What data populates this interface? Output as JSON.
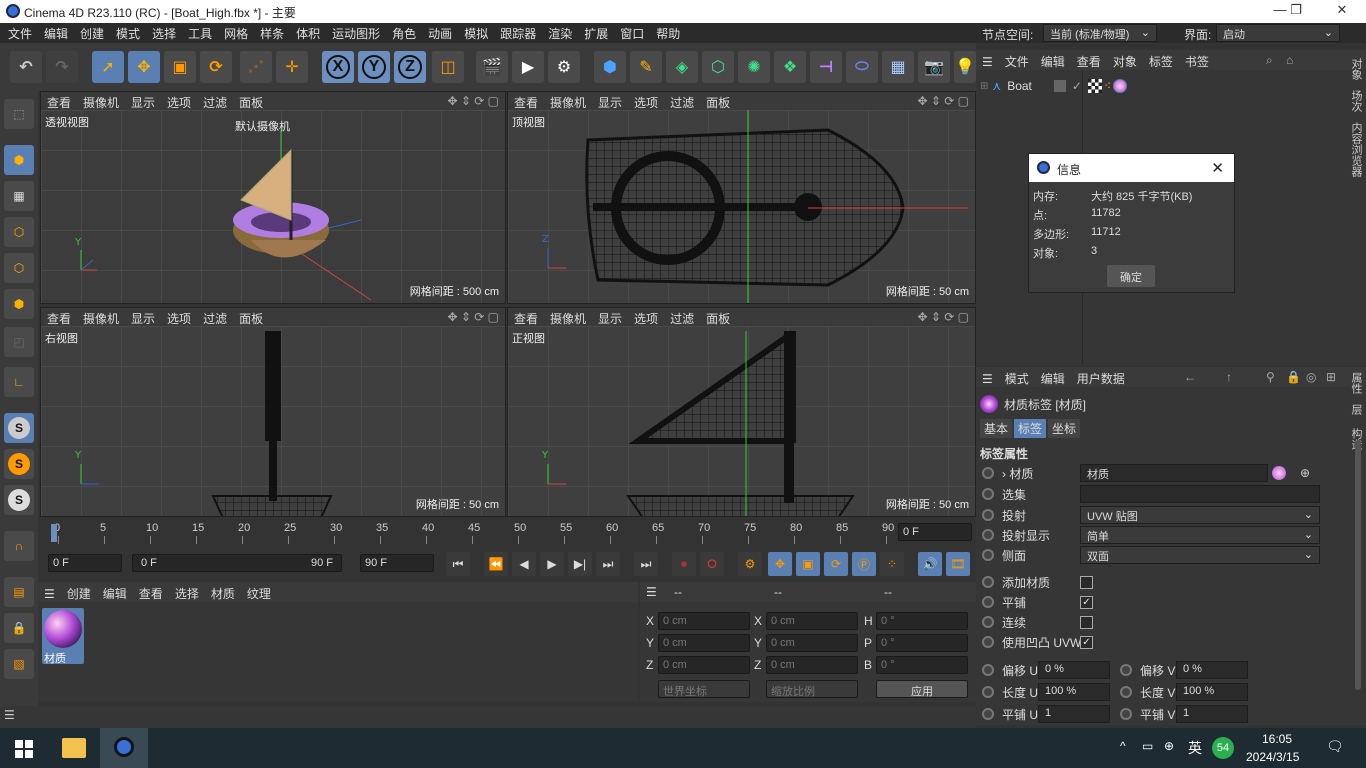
{
  "window": {
    "title": "Cinema 4D R23.110 (RC) - [Boat_High.fbx *] - 主要",
    "minimize": "—",
    "maximize": "❐",
    "close": "✕"
  },
  "menubar": {
    "items": [
      "文件",
      "编辑",
      "创建",
      "模式",
      "选择",
      "工具",
      "网格",
      "样条",
      "体积",
      "运动图形",
      "角色",
      "动画",
      "模拟",
      "跟踪器",
      "渲染",
      "扩展",
      "窗口",
      "帮助"
    ],
    "node_space_label": "节点空间:",
    "node_space_value": "当前 (标准/物理)",
    "interface_label": "界面:",
    "interface_value": "启动"
  },
  "toolbar": {
    "axis_x": "X",
    "axis_y": "Y",
    "axis_z": "Z"
  },
  "viewports": {
    "menu": [
      "查看",
      "摄像机",
      "显示",
      "选项",
      "过滤",
      "面板"
    ],
    "perspective": {
      "label": "透视视图",
      "camera": "默认摄像机",
      "grid": "网格间距 : 500 cm"
    },
    "top": {
      "label": "顶视图",
      "grid": "网格间距 : 50 cm"
    },
    "right": {
      "label": "右视图",
      "grid": "网格间距 : 50 cm"
    },
    "front": {
      "label": "正视图",
      "grid": "网格间距 : 50 cm"
    }
  },
  "timeline": {
    "ticks": [
      "0",
      "5",
      "10",
      "15",
      "20",
      "25",
      "30",
      "35",
      "40",
      "45",
      "50",
      "55",
      "60",
      "65",
      "70",
      "75",
      "80",
      "85",
      "90"
    ],
    "end_frame": "0 F",
    "current_frame": "0 F",
    "range_start": "0 F",
    "range_end": "90 F",
    "max_frame": "90 F"
  },
  "material_manager": {
    "menu": [
      "创建",
      "编辑",
      "查看",
      "选择",
      "材质",
      "纹理"
    ],
    "material_name": "材质"
  },
  "coordinates": {
    "headers": [
      "--",
      "--",
      "--"
    ],
    "x_label": "X",
    "y_label": "Y",
    "z_label": "Z",
    "px": "0 cm",
    "py": "0 cm",
    "pz": "0 cm",
    "sx": "0 cm",
    "sy": "0 cm",
    "sz": "0 cm",
    "h_label": "H",
    "p_label": "P",
    "b_label": "B",
    "h": "0 °",
    "p": "0 °",
    "b": "0 °",
    "world_coord": "世界坐标",
    "scale_ratio": "缩放比例",
    "apply": "应用"
  },
  "object_manager": {
    "menu": [
      "文件",
      "编辑",
      "查看",
      "对象",
      "标签",
      "书签"
    ],
    "object_name": "Boat"
  },
  "info_dialog": {
    "title": "信息",
    "memory_label": "内存:",
    "memory_value": "大约 825 千字节(KB)",
    "points_label": "点:",
    "points_value": "11782",
    "polygons_label": "多边形:",
    "polygons_value": "11712",
    "objects_label": "对象:",
    "objects_value": "3",
    "ok": "确定"
  },
  "attribute_manager": {
    "menu": [
      "模式",
      "编辑",
      "用户数据"
    ],
    "title": "材质标签 [材质]",
    "tabs": [
      "基本",
      "标签",
      "坐标"
    ],
    "section": "标签属性",
    "material_label": "材质",
    "material_value": "材质",
    "selection_label": "选集",
    "projection_label": "投射",
    "projection_value": "UVW 贴图",
    "projection_display_label": "投射显示",
    "projection_display_value": "简单",
    "side_label": "侧面",
    "side_value": "双面",
    "add_material_label": "添加材质",
    "tile_label": "平铺",
    "seamless_label": "连续",
    "use_bump_uvw_label": "使用凹凸 UVW",
    "offset_u_label": "偏移 U",
    "offset_u_value": "0 %",
    "offset_v_label": "偏移 V",
    "offset_v_value": "0 %",
    "length_u_label": "长度 U",
    "length_u_value": "100 %",
    "length_v_label": "长度 V",
    "length_v_value": "100 %",
    "tiles_u_label": "平铺 U",
    "tiles_u_value": "1",
    "tiles_v_label": "平铺 V",
    "tiles_v_value": "1"
  },
  "side_tabs": {
    "top": "对象",
    "top2": "场次",
    "top3": "内容浏览器",
    "bottom": "属性",
    "bottom2": "层",
    "bottom3": "构造"
  },
  "taskbar": {
    "ime": "英",
    "badge": "54",
    "time": "16:05",
    "date": "2024/3/15"
  },
  "colors": {
    "accent": "#5a7fb3",
    "panel": "#363636",
    "dark": "#2b2b2b"
  }
}
